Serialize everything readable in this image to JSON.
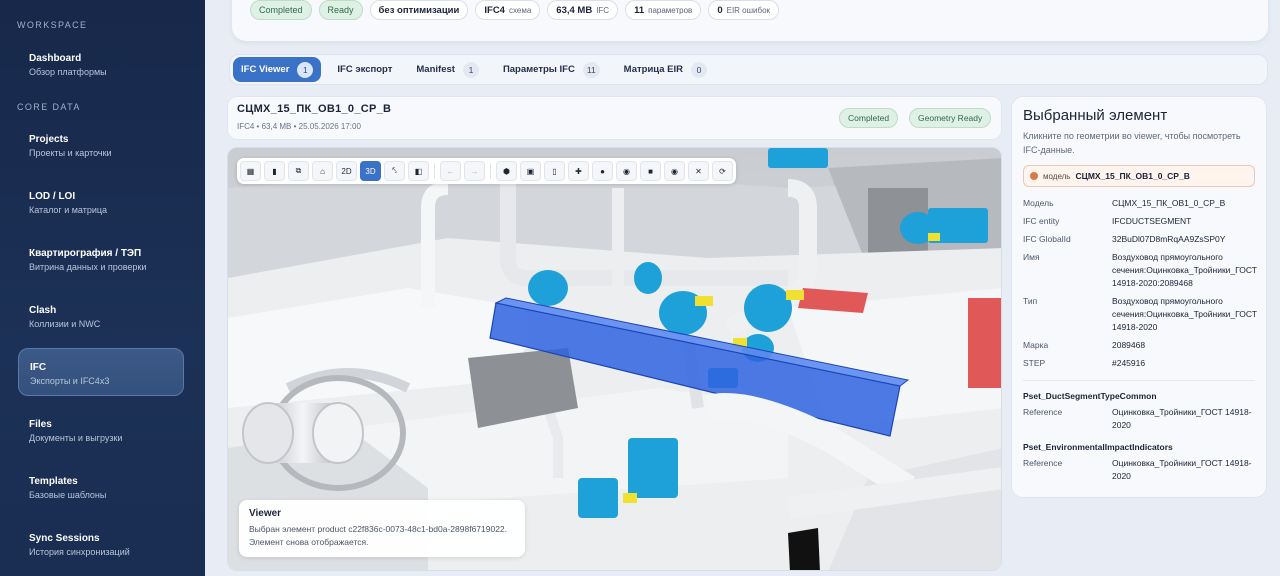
{
  "sidebar": {
    "workspace_label": "WORKSPACE",
    "core_label": "CORE DATA",
    "items": [
      {
        "title": "Dashboard",
        "subtitle": "Обзор платформы"
      },
      {
        "title": "Projects",
        "subtitle": "Проекты и карточки"
      },
      {
        "title": "LOD / LOI",
        "subtitle": "Каталог и матрица"
      },
      {
        "title": "Квартирография / ТЭП",
        "subtitle": "Витрина данных и проверки"
      },
      {
        "title": "Clash",
        "subtitle": "Коллизии и NWC"
      },
      {
        "title": "IFC",
        "subtitle": "Экспорты и IFC4x3",
        "active": true
      },
      {
        "title": "Files",
        "subtitle": "Документы и выгрузки"
      },
      {
        "title": "Templates",
        "subtitle": "Базовые шаблоны"
      },
      {
        "title": "Sync Sessions",
        "subtitle": "История синхронизаций"
      }
    ]
  },
  "summary": {
    "status_completed": "Completed",
    "status_ready": "Ready",
    "optimization": "без оптимизации",
    "schema_value": "IFC4",
    "schema_label": "схема",
    "size_value": "63,4 MB",
    "size_label": "IFC",
    "params_value": "11",
    "params_label": "параметров",
    "eir_value": "0",
    "eir_label": "EIR ошибок"
  },
  "tabs": [
    {
      "label": "IFC Viewer",
      "badge": "1",
      "active": true
    },
    {
      "label": "IFC экспорт",
      "badge": ""
    },
    {
      "label": "Manifest",
      "badge": "1"
    },
    {
      "label": "Параметры IFC",
      "badge": "11"
    },
    {
      "label": "Матрица EIR",
      "badge": "0"
    }
  ],
  "model": {
    "name": "СЦМХ_15_ПК_ОВ1_0_СР_В",
    "meta": "IFC4 • 63,4 MB • 25.05.2026 17:00",
    "badge_completed": "Completed",
    "badge_geometry": "Geometry Ready"
  },
  "toolbar": {
    "view2d": "2D",
    "view3d": "3D"
  },
  "toast": {
    "title": "Viewer",
    "text": "Выбран элемент product c22f836c-0073-48c1-bd0a-2898f6719022. Элемент снова отображается."
  },
  "panel": {
    "title": "Выбранный элемент",
    "hint": "Кликните по геометрии во viewer, чтобы посмотреть IFC-данные.",
    "model_label": "модель",
    "model_name": "СЦМХ_15_ПК_ОВ1_0_СР_В",
    "props": [
      {
        "key": "Модель",
        "value": "СЦМХ_15_ПК_ОВ1_0_СР_В"
      },
      {
        "key": "IFC entity",
        "value": "IFCDUCTSEGMENT"
      },
      {
        "key": "IFC GlobalId",
        "value": "32BuDl07D8mRqAA9ZsSP0Y"
      },
      {
        "key": "Имя",
        "value": "Воздуховод прямоугольного сечения:Оцинковка_Тройники_ГОСТ 14918-2020:2089468"
      },
      {
        "key": "Тип",
        "value": "Воздуховод прямоугольного сечения:Оцинковка_Тройники_ГОСТ 14918-2020"
      },
      {
        "key": "Марка",
        "value": "2089468"
      },
      {
        "key": "STEP",
        "value": "#245916"
      }
    ],
    "psets": [
      {
        "name": "Pset_DuctSegmentTypeCommon",
        "key": "Reference",
        "value": "Оцинковка_Тройники_ГОСТ 14918-2020"
      },
      {
        "name": "Pset_EnvironmentalImpactIndicators",
        "key": "Reference",
        "value": "Оцинковка_Тройники_ГОСТ 14918-2020"
      }
    ]
  },
  "colors": {
    "sidebar_bg": "#17284a",
    "accent": "#3a72c7",
    "selection": "#2f63e0",
    "equipment": "#1ea0d8",
    "status_green_bg": "#dff1e4"
  }
}
